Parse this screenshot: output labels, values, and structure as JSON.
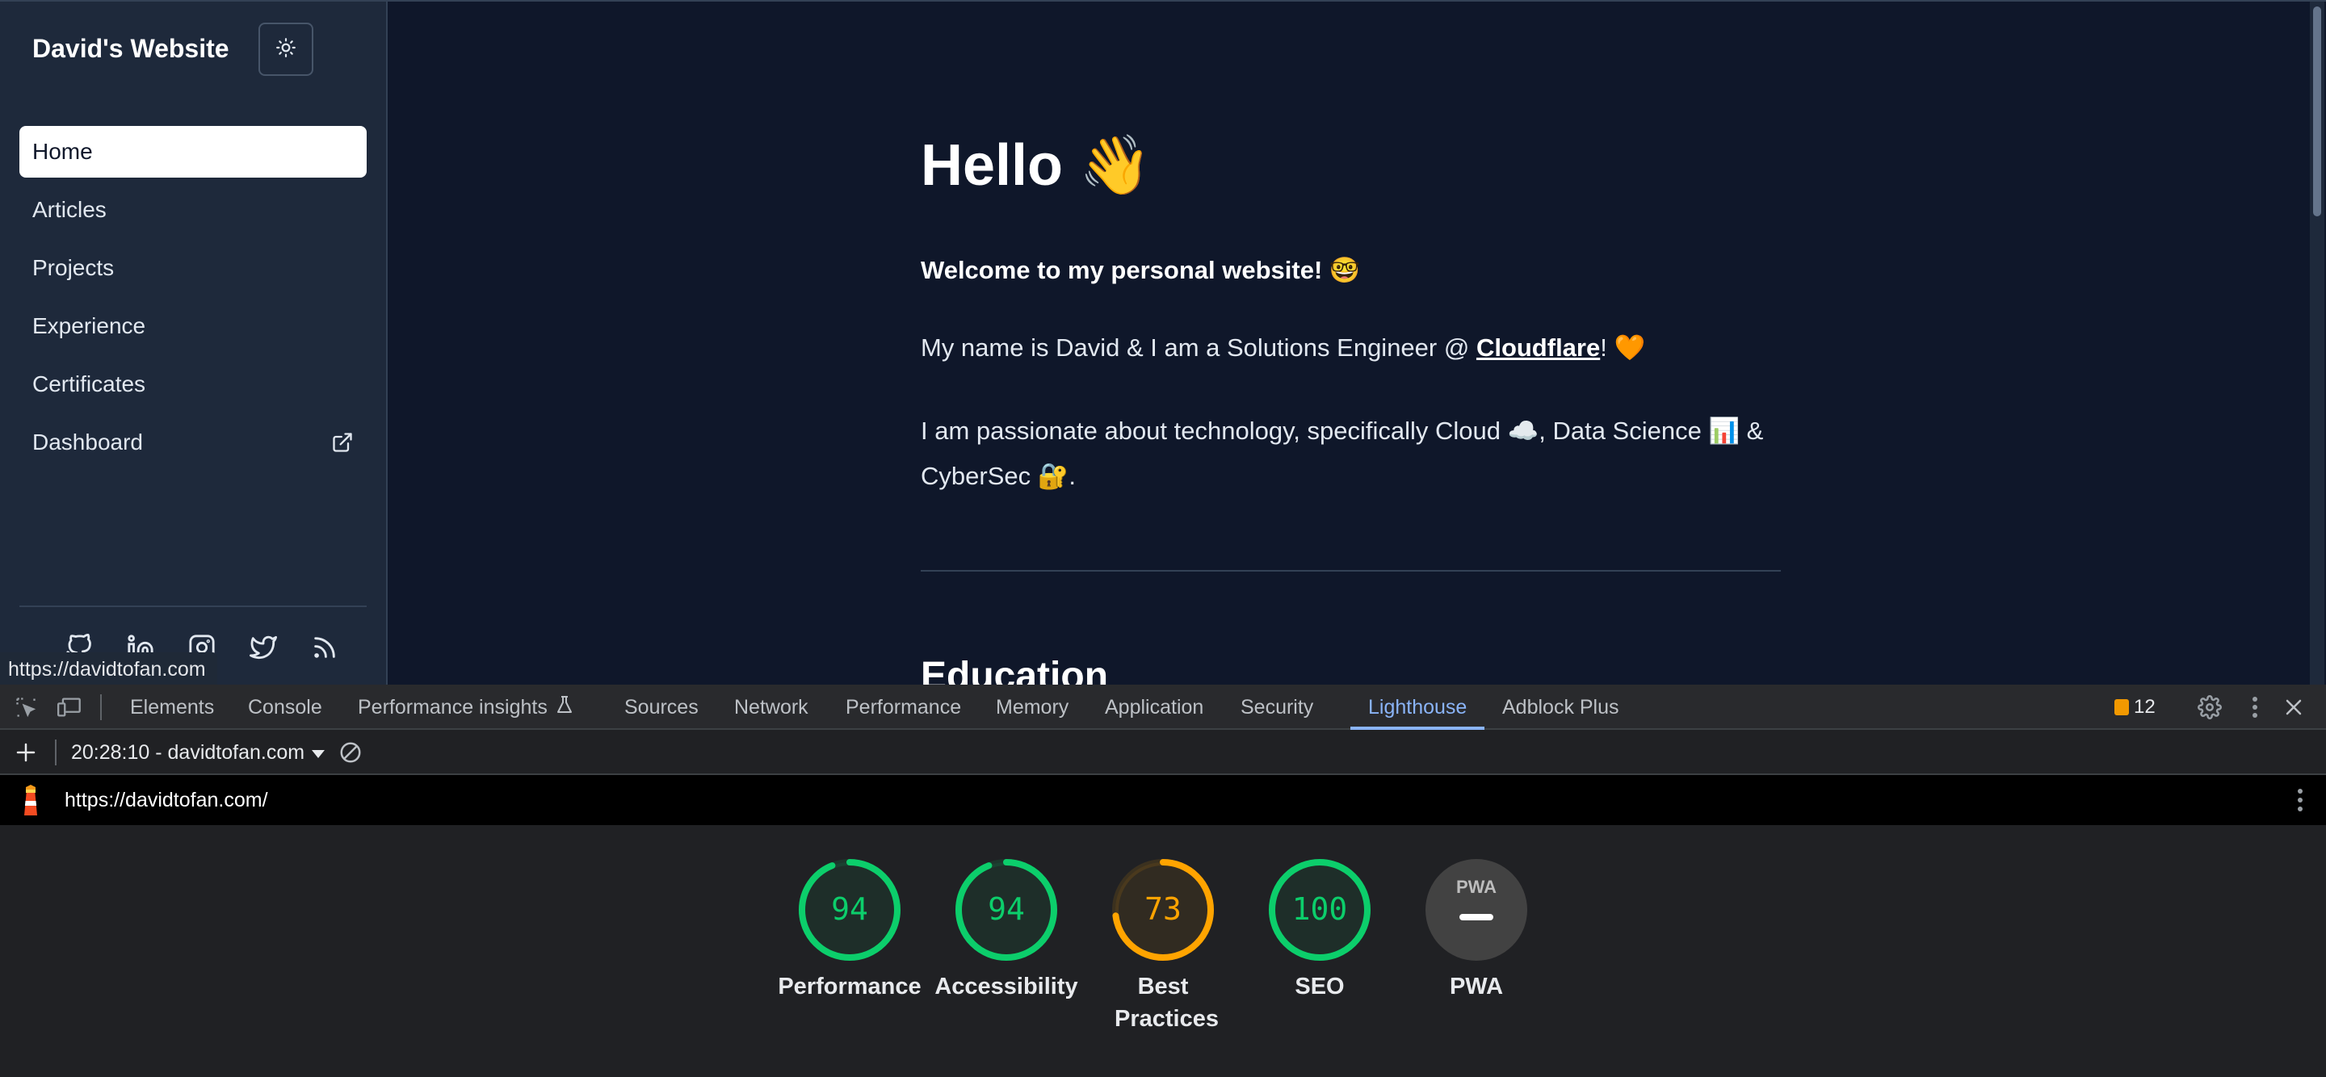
{
  "site": {
    "title": "David's Website",
    "nav": [
      {
        "label": "Home",
        "active": true
      },
      {
        "label": "Articles"
      },
      {
        "label": "Projects"
      },
      {
        "label": "Experience"
      },
      {
        "label": "Certificates"
      },
      {
        "label": "Dashboard",
        "external": true
      }
    ],
    "socials": [
      "github-icon",
      "linkedin-icon",
      "instagram-icon",
      "twitter-icon",
      "rss-icon"
    ],
    "hover_url": "https://davidtofan.com",
    "main": {
      "hello": "Hello 👋",
      "welcome": "Welcome to my personal website! 🤓",
      "intro_pre": "My name is David & I am a Solutions Engineer @ ",
      "intro_link": "Cloudflare",
      "intro_post": "! 🧡",
      "passion": "I am passionate about technology, specifically Cloud ☁️, Data Science 📊 & CyberSec 🔐.",
      "next_section": "Education"
    }
  },
  "devtools": {
    "tabs": [
      "Elements",
      "Console",
      "Performance insights",
      "Sources",
      "Network",
      "Performance",
      "Memory",
      "Application",
      "Security",
      "Lighthouse",
      "Adblock Plus"
    ],
    "active_tab": "Lighthouse",
    "issues_count": "12",
    "report_select": "20:28:10 - davidtofan.com",
    "report_url": "https://davidtofan.com/",
    "colors": {
      "pass": "#0cce6b",
      "average": "#ffa400",
      "neutral": "#5f6368"
    },
    "scores": [
      {
        "label": "Performance",
        "value": "94",
        "fraction": 0.94,
        "rating": "pass"
      },
      {
        "label": "Accessibility",
        "value": "94",
        "fraction": 0.94,
        "rating": "pass"
      },
      {
        "label": "Best Practices",
        "value": "73",
        "fraction": 0.73,
        "rating": "average"
      },
      {
        "label": "SEO",
        "value": "100",
        "fraction": 1.0,
        "rating": "pass"
      },
      {
        "label": "PWA",
        "value": "",
        "fraction": 0,
        "rating": "neutral",
        "badge": "PWA"
      }
    ]
  }
}
